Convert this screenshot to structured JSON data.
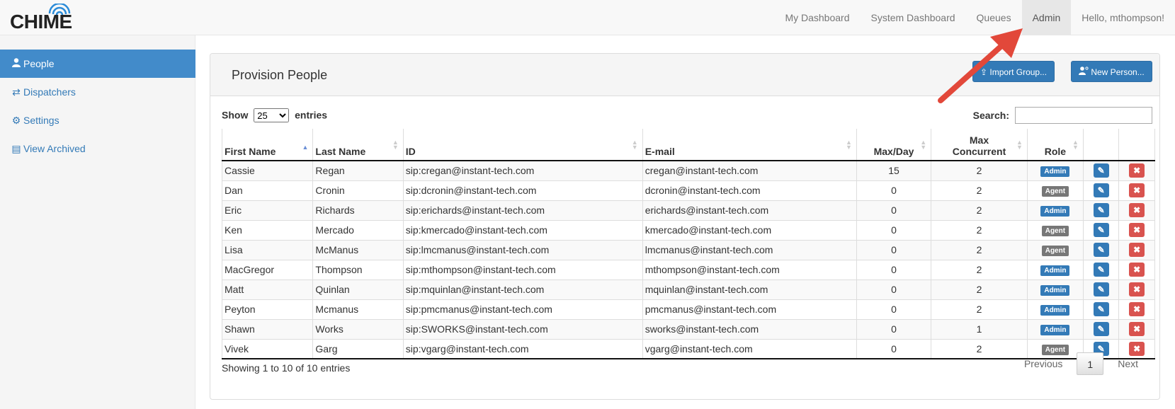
{
  "app": {
    "logo": "CHIME"
  },
  "nav": {
    "items": [
      "My Dashboard",
      "System Dashboard",
      "Queues",
      "Admin",
      "Hello, mthompson!"
    ],
    "active": "Admin"
  },
  "sidebar": {
    "items": [
      {
        "label": "People",
        "icon": "user-icon"
      },
      {
        "label": "Dispatchers",
        "icon": "transfer-icon"
      },
      {
        "label": "Settings",
        "icon": "gear-icon"
      },
      {
        "label": "View Archived",
        "icon": "archive-icon"
      }
    ]
  },
  "panel": {
    "title": "Provision People",
    "import_button": "Import Group...",
    "new_button": "New Person..."
  },
  "controls": {
    "show_label": "Show",
    "entries_label": "entries",
    "page_length": "25",
    "search_label": "Search:",
    "search_value": ""
  },
  "table": {
    "headers": [
      "First Name",
      "Last Name",
      "ID",
      "E-mail",
      "Max/Day",
      "Max Concurrent",
      "Role"
    ],
    "rows": [
      [
        "Cassie",
        "Regan",
        "sip:cregan@instant-tech.com",
        "cregan@instant-tech.com",
        "15",
        "2",
        "Admin"
      ],
      [
        "Dan",
        "Cronin",
        "sip:dcronin@instant-tech.com",
        "dcronin@instant-tech.com",
        "0",
        "2",
        "Agent"
      ],
      [
        "Eric",
        "Richards",
        "sip:erichards@instant-tech.com",
        "erichards@instant-tech.com",
        "0",
        "2",
        "Admin"
      ],
      [
        "Ken",
        "Mercado",
        "sip:kmercado@instant-tech.com",
        "kmercado@instant-tech.com",
        "0",
        "2",
        "Agent"
      ],
      [
        "Lisa",
        "McManus",
        "sip:lmcmanus@instant-tech.com",
        "lmcmanus@instant-tech.com",
        "0",
        "2",
        "Agent"
      ],
      [
        "MacGregor",
        "Thompson",
        "sip:mthompson@instant-tech.com",
        "mthompson@instant-tech.com",
        "0",
        "2",
        "Admin"
      ],
      [
        "Matt",
        "Quinlan",
        "sip:mquinlan@instant-tech.com",
        "mquinlan@instant-tech.com",
        "0",
        "2",
        "Admin"
      ],
      [
        "Peyton",
        "Mcmanus",
        "sip:pmcmanus@instant-tech.com",
        "pmcmanus@instant-tech.com",
        "0",
        "2",
        "Admin"
      ],
      [
        "Shawn",
        "Works",
        "sip:SWORKS@instant-tech.com",
        "sworks@instant-tech.com",
        "0",
        "1",
        "Admin"
      ],
      [
        "Vivek",
        "Garg",
        "sip:vgarg@instant-tech.com",
        "vgarg@instant-tech.com",
        "0",
        "2",
        "Agent"
      ]
    ]
  },
  "footer": {
    "info": "Showing 1 to 10 of 10 entries",
    "previous": "Previous",
    "page": "1",
    "next": "Next"
  },
  "colors": {
    "primary": "#337ab7",
    "danger": "#d9534f",
    "annotation_arrow": "#e2483a"
  }
}
